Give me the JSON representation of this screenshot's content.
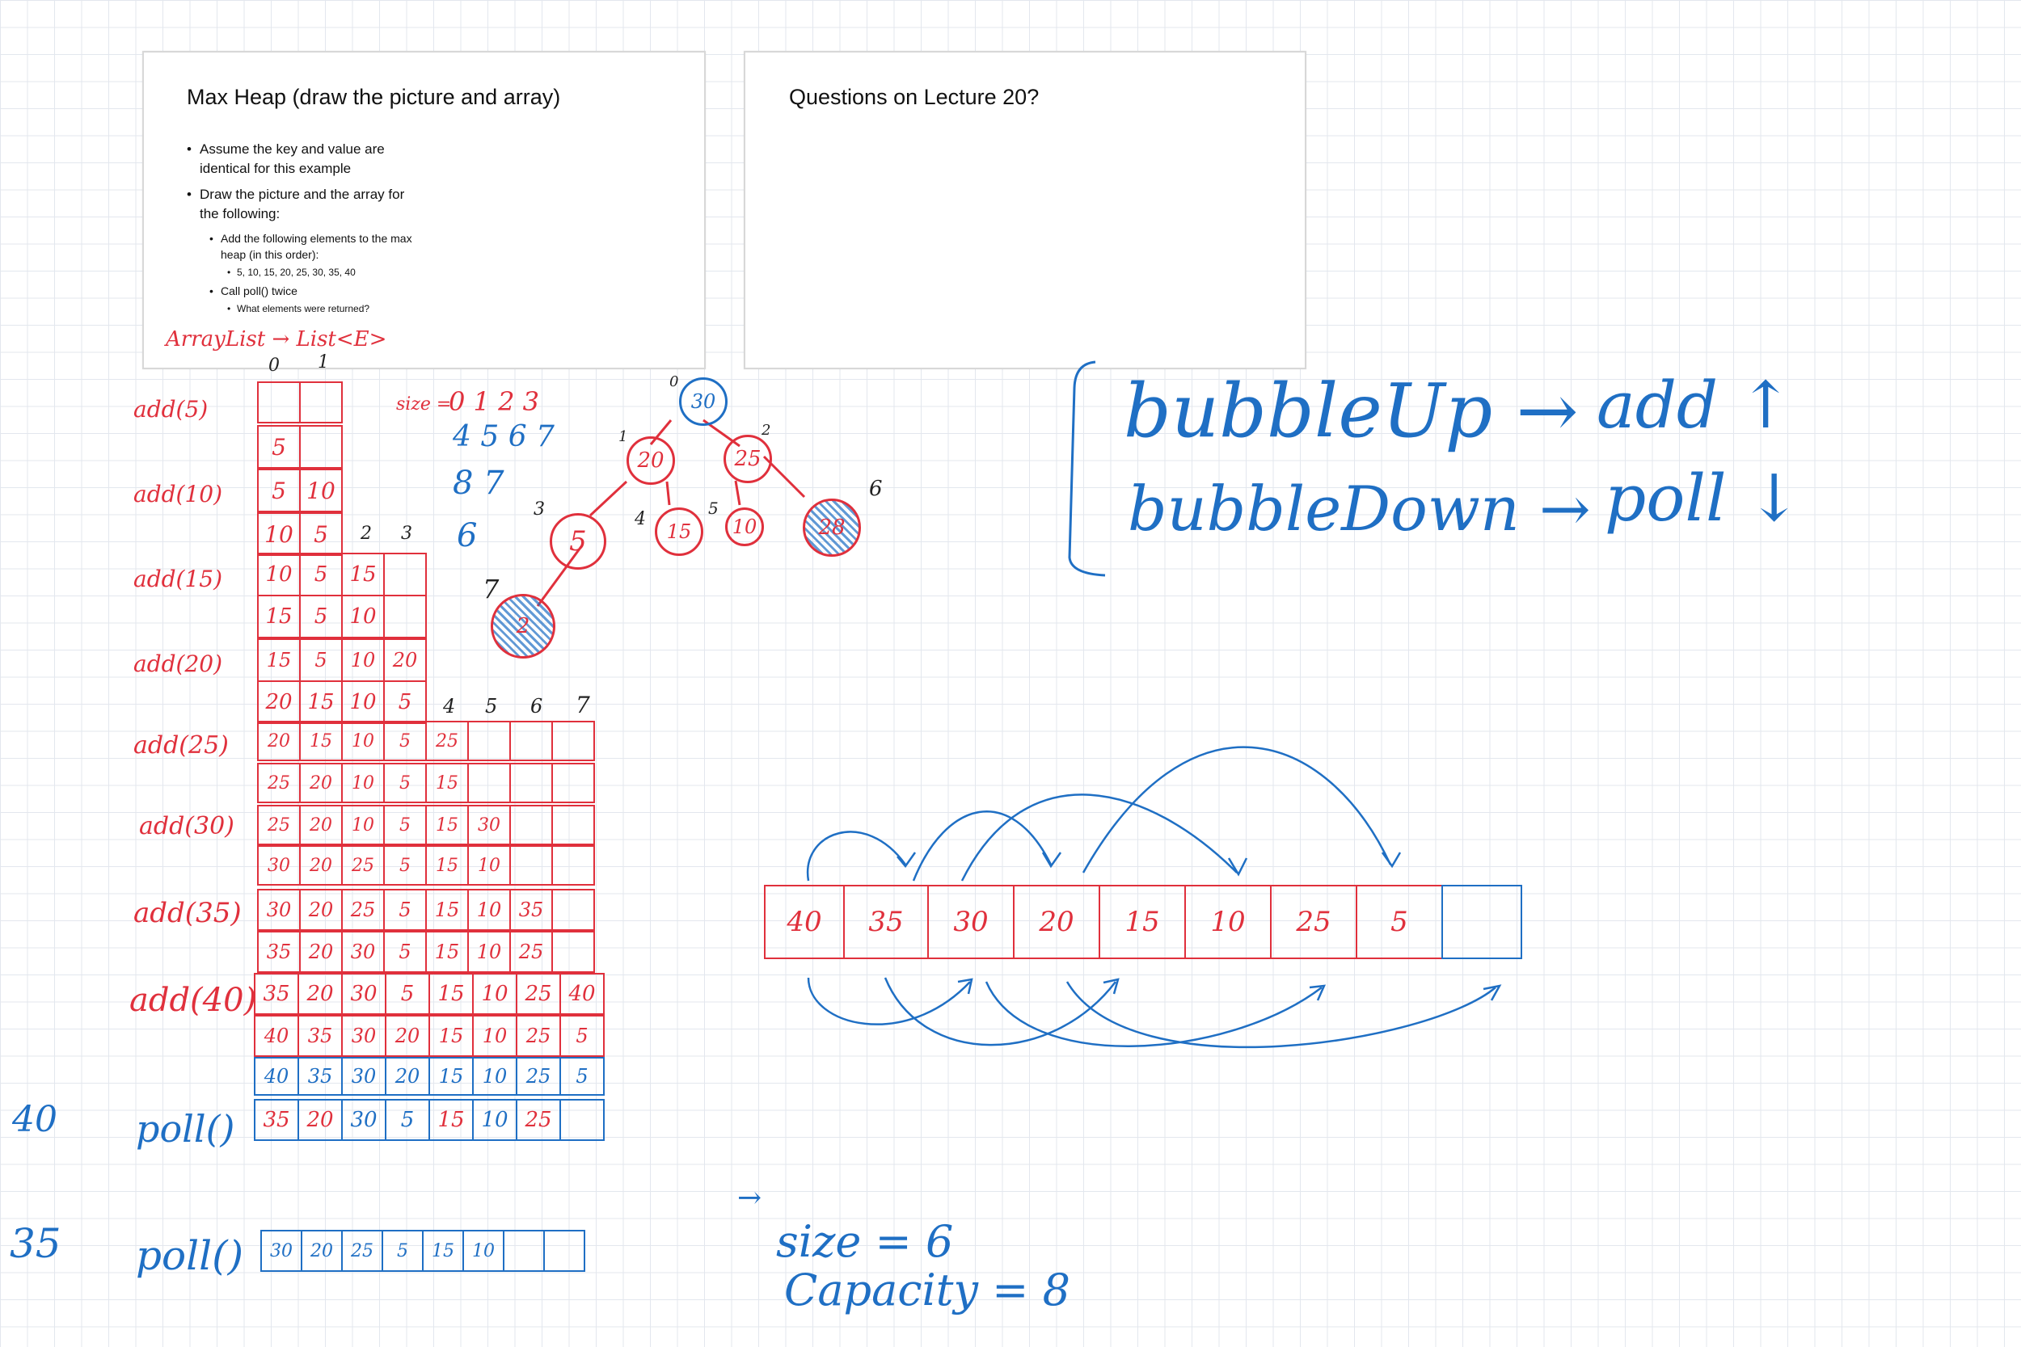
{
  "slide1": {
    "title": "Max Heap (draw the picture and array)",
    "bullet1": "Assume the key and value are identical for this example",
    "bullet2": "Draw the picture and the array for the following:",
    "sub1": "Add the following elements to the max heap (in this order):",
    "sub1_values": "5, 10, 15, 20, 25, 30, 35, 40",
    "sub2": "Call poll() twice",
    "sub2_q": "What elements were returned?"
  },
  "slide2": {
    "title": "Questions on Lecture 20?"
  },
  "annotations": {
    "arraylist": "ArrayList → List<E>",
    "size_label": "size =",
    "size_seq_1": "0 1 2 3",
    "size_seq_2": "4 5 6 7",
    "size_seq_3": "8 7",
    "size_seq_4": "6",
    "bubble_up": "bubbleUp →",
    "bubble_up_target": "add ↑",
    "bubble_down": "bubbleDown →",
    "bubble_down_target": "poll ↓",
    "returned_1": "40",
    "returned_2": "35",
    "size_final": "size = 6",
    "capacity_final": "Capacity = 8",
    "arrow_mark": "→"
  },
  "index_labels": {
    "top": [
      "0",
      "1"
    ],
    "mid": [
      "2",
      "3"
    ],
    "right": [
      "4",
      "5",
      "6",
      "7"
    ]
  },
  "operations": [
    "add(5)",
    "add(10)",
    "add(15)",
    "add(20)",
    "add(25)",
    "add(30)",
    "add(35)",
    "add(40)",
    "poll()",
    "poll()"
  ],
  "rows": [
    [],
    [
      "5",
      ""
    ],
    [
      "5",
      "10"
    ],
    [
      "10",
      "5"
    ],
    [
      "10",
      "5",
      "15",
      ""
    ],
    [
      "15",
      "5",
      "10",
      ""
    ],
    [
      "15",
      "5",
      "10",
      "20"
    ],
    [
      "20",
      "15",
      "10",
      "5"
    ],
    [
      "20",
      "15",
      "10",
      "5",
      "25",
      "",
      "",
      ""
    ],
    [
      "25",
      "20",
      "10",
      "5",
      "15",
      "",
      "",
      ""
    ],
    [
      "25",
      "20",
      "10",
      "5",
      "15",
      "30",
      "",
      ""
    ],
    [
      "30",
      "20",
      "25",
      "5",
      "15",
      "10",
      "",
      ""
    ],
    [
      "30",
      "20",
      "25",
      "5",
      "15",
      "10",
      "35",
      ""
    ],
    [
      "35",
      "20",
      "30",
      "5",
      "15",
      "10",
      "25",
      ""
    ],
    [
      "35",
      "20",
      "30",
      "5",
      "15",
      "10",
      "25",
      "40"
    ],
    [
      "40",
      "35",
      "30",
      "20",
      "15",
      "10",
      "25",
      "5"
    ],
    [
      "40",
      "35",
      "30",
      "20",
      "15",
      "10",
      "25",
      "5"
    ],
    [
      "35",
      "20",
      "30",
      "5",
      "15",
      "10",
      "25",
      ""
    ],
    [
      "30",
      "20",
      "25",
      "5",
      "15",
      "10",
      "",
      ""
    ]
  ],
  "tree": {
    "nodes": [
      "30",
      "20",
      "25",
      "5",
      "15",
      "10",
      "28",
      "2"
    ],
    "indices": [
      "0",
      "1",
      "2",
      "3",
      "4",
      "5",
      "6",
      "7"
    ]
  },
  "big_array": [
    "40",
    "35",
    "30",
    "20",
    "15",
    "10",
    "25",
    "5",
    ""
  ]
}
